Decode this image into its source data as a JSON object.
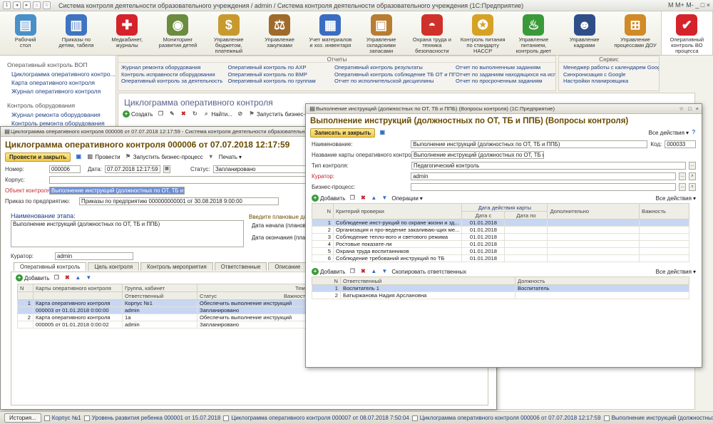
{
  "app": {
    "title": "Система контроля деятельности образовательного учреждения / admin / Система контроля деятельности образовательного учреждения  (1С:Предприятие)",
    "title_right": "M   M+  M-  _  □  ×"
  },
  "sections": [
    {
      "label": "Рабочий\nстол",
      "icon": "desktop-icon",
      "color": "#4a90c8",
      "glyph": "▤"
    },
    {
      "label": "Приказы по\nдетям, табеля",
      "icon": "chart-icon",
      "color": "#3f74c0",
      "glyph": "▥"
    },
    {
      "label": "Медкабинет,\nжурналы",
      "icon": "medical-cross-icon",
      "color": "#d4232a",
      "glyph": "✚"
    },
    {
      "label": "Мониторинг\nразвития детей",
      "icon": "globe-icon",
      "color": "#6b8c3e",
      "glyph": "◉"
    },
    {
      "label": "Управление бюджетом,\nплатежный календарь",
      "icon": "money-bag-icon",
      "color": "#c89a2e",
      "glyph": "$"
    },
    {
      "label": "Управление\nзакупками",
      "icon": "scales-icon",
      "color": "#a06a2a",
      "glyph": "⚖"
    },
    {
      "label": "Учет материалов\nи хоз. инвентаря",
      "icon": "inventory-icon",
      "color": "#3a6cc2",
      "glyph": "▦"
    },
    {
      "label": "Управление\nскладскими запасами",
      "icon": "boxes-icon",
      "color": "#b87d33",
      "glyph": "▣"
    },
    {
      "label": "Охрана труда и\nтехника безопасности",
      "icon": "helmet-icon",
      "color": "#d0302a",
      "glyph": "◓"
    },
    {
      "label": "Контроль питания\nпо стандарту HACCP",
      "icon": "haccp-badge-icon",
      "color": "#d6a226",
      "glyph": "✪"
    },
    {
      "label": "Управление питанием,\nконтроль диет",
      "icon": "fork-knife-icon",
      "color": "#3a9a3a",
      "glyph": "♨"
    },
    {
      "label": "Управление\nкадрами",
      "icon": "person-icon",
      "color": "#2f4e88",
      "glyph": "☻"
    },
    {
      "label": "Управление\nпроцессами ДОУ",
      "icon": "process-icon",
      "color": "#d18a26",
      "glyph": "⊞"
    },
    {
      "label": "Оперативный\nконтроль ВО процесса",
      "icon": "checkmark-icon",
      "color": "#d4232a",
      "glyph": "✔"
    }
  ],
  "leftnav": {
    "group1": "Оперативный контроль ВОП",
    "items1": [
      "Циклограмма оперативного контро...",
      "Карта оперативного контроля",
      "Журнал оперативного контроля"
    ],
    "group2": "Контроль оборудования",
    "items2": [
      "Журнал ремонта оборудования",
      "Контроль ремонта оборудования"
    ]
  },
  "reports": {
    "header": "Отчеты",
    "col1": [
      "Журнал ремонта оборудования",
      "Контроль исправности оборудования",
      "Оперативный контроль за деятельность"
    ],
    "col2": [
      "Оперативный контроль по АХР",
      "Оперативный контроль по ВМР",
      "Оперативный контроль по группам"
    ],
    "col3": [
      "Оперативный контроль результаты",
      "Оперативный контроль соблюдение ТБ ОТ и ППБ",
      "Отчет по исполнительской дисциплины"
    ],
    "col4": [
      "Отчет по выполненным заданиям",
      "Отчет по заданиям находящихся на исполнении",
      "Отчет по просроченным заданиям"
    ]
  },
  "service": {
    "header": "Сервис",
    "items": [
      "Менеджер работы с календарем Google",
      "Синхронизация с Google",
      "Настройки планировщика"
    ]
  },
  "main": {
    "title": "Циклограмма оперативного контроля",
    "toolbar": {
      "create": "Создать",
      "find": "Найти...",
      "start_bp": "Запустить бизнес-проц"
    }
  },
  "winA": {
    "titlebar": "Циклограмма оперативного контроля 000006 от 07.07.2018 12:17:59 - Система контроля деятельности образовательн",
    "header": "Циклограмма оперативного контроля 000006 от 07.07.2018 12:17:59",
    "btn_post_close": "Провести и закрыть",
    "btn_post": "Провести",
    "btn_start_bp": "Запустить бизнес-процесс",
    "btn_print": "Печать",
    "number_label": "Номер:",
    "number": "000006",
    "date_label": "Дата:",
    "date": "07.07.2018 12:17:59",
    "status_label": "Статус:",
    "status": "Запланировано",
    "building_label": "Корпус:",
    "object_label": "Объект контроля:",
    "object": "Выполнение инструкций (должностных по ОТ, ТБ и ППБ)",
    "order_label": "Приказ по предприятию:",
    "order": "Приказы по предприятию 000000000001 от 30.08.2018 9:00:00",
    "stage_label": "Наименование этапа:",
    "stage": "Выполнение инструкций (должностных по ОТ, ТБ и ППБ)",
    "plan_header": "Введите плановые дат",
    "start_label": "Дата начала (плановая)",
    "end_label": "Дата окончания (плано",
    "curator_label": "Куратор:",
    "curator": "admin",
    "tabs": [
      "Оперативный контроль",
      "Цель контроля",
      "Контроль мероприятия",
      "Ответственные",
      "Описание"
    ],
    "add": "Добавить",
    "table_headers": {
      "n": "N",
      "card": "Карты оперативного контроля",
      "group": "Группа, кабинет",
      "resp": "Ответственный",
      "status": "Статус",
      "theme": "Тема",
      "imp": "Важность"
    },
    "rows": [
      {
        "n": "1",
        "card1": "Карта оперативного контроля",
        "card2": "000003 от 01.01.2018 0:00:00",
        "group": "Корпус №1",
        "resp": "admin",
        "status1": "Обеспечить выполнение инструкций",
        "status2": "Запланировано",
        "imp": "!"
      },
      {
        "n": "2",
        "card1": "Карта оперативного контроля",
        "card2": "000005 от 01.01.2018 0:00:02",
        "group": "1а",
        "resp": "admin",
        "status1": "Обеспечить выполнение инструкций",
        "status2": "Запланировано",
        "imp": "!"
      }
    ]
  },
  "winB": {
    "titlebar": "Выполнение инструкций (должностных по ОТ, ТБ и ППБ) (Вопросы контроля)  (1С:Предприятие)",
    "header": "Выполнение инструкций (должностных по ОТ, ТБ и ППБ) (Вопросы контроля)",
    "btn_save_close": "Записать и закрыть",
    "all_actions": "Все действия",
    "name_label": "Наименование:",
    "name": "Выполнение инструкций (должностных по ОТ, ТБ и ППБ)",
    "code_label": "Код:",
    "code": "000033",
    "card_label": "Название карты оперативного контроля:",
    "card": "Выполнение инструкций (должностных по ОТ, ТБ и ППБ)",
    "type_label": "Тип контроля:",
    "type": "Педагогический контроль",
    "curator_label": "Куратор:",
    "curator": "admin",
    "bp_label": "Бизнес-процесс:",
    "add": "Добавить",
    "operations": "Операции",
    "crit_headers": {
      "n": "N",
      "crit": "Критерий проверки",
      "dates": "Дата действия карты",
      "from": "Дата с",
      "to": "Дата по",
      "extra": "Дополнительно",
      "imp": "Важность"
    },
    "criteria": [
      {
        "n": "1",
        "text": "Соблюдение инст-рукций по охране жизни и зд...",
        "from": "01.01.2018"
      },
      {
        "n": "2",
        "text": "Организация и про-ведение закаливаю-щих ме...",
        "from": "01.01.2018"
      },
      {
        "n": "3",
        "text": "Соблюдение тепло-вого и светового режима",
        "from": "01.01.2018"
      },
      {
        "n": "4",
        "text": "Ростовые показате-ли",
        "from": "01.01.2018"
      },
      {
        "n": "5",
        "text": "Охрана труда воспитанников",
        "from": "01.01.2018"
      },
      {
        "n": "6",
        "text": "Соблюдение требований инструкций по ТБ",
        "from": "01.01.2018"
      }
    ],
    "copy_resp": "Скопировать ответственных",
    "resp_headers": {
      "n": "N",
      "resp": "Ответственный",
      "pos": "Должность"
    },
    "responsibles": [
      {
        "n": "1",
        "name": "Воспитатель 1",
        "pos": "Воспитатель"
      },
      {
        "n": "2",
        "name": "Батыржанова Надия Арслановна",
        "pos": ""
      }
    ]
  },
  "statusbar": {
    "history": "История...",
    "items": [
      "Корпус №1",
      "Уровень развития ребенка 000001 от 15.07.2018",
      "Циклограмма оперативного контроля 000007 от 08.07.2018 7:50:04",
      "Циклограмма оперативного контроля 000006 от 07.07.2018 12:17:59",
      "Выполнение инструкций (должностных по ОТ, ТБ и ППБ)"
    ]
  }
}
